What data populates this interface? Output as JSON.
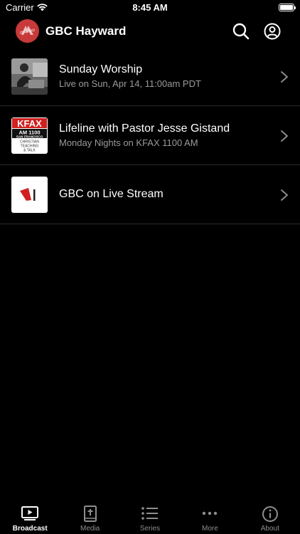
{
  "status_bar": {
    "carrier": "Carrier",
    "time": "8:45 AM"
  },
  "nav": {
    "title": "GBC Hayward",
    "logo_icon": "church-logo-icon",
    "search_icon": "search-icon",
    "account_icon": "account-icon"
  },
  "broadcasts": [
    {
      "title": "Sunday Worship",
      "subtitle": "Live on Sun, Apr 14, 11:00am PDT",
      "thumb": "pastor-photo"
    },
    {
      "title": "Lifeline with Pastor Jesse Gistand",
      "subtitle": "Monday Nights on KFAX 1100 AM",
      "thumb": "kfax-logo",
      "logo_text": {
        "brand": "KFAX",
        "freq": "AM 1100",
        "city": "SAN FRANCISCO",
        "tag1": "CHRISTIAN",
        "tag2": "TEACHING",
        "tag3": "& TALK"
      }
    },
    {
      "title": "GBC on Live Stream",
      "subtitle": "",
      "thumb": "livestream-logo"
    }
  ],
  "tabs": [
    {
      "label": "Broadcast",
      "icon": "play-screen-icon",
      "active": true
    },
    {
      "label": "Media",
      "icon": "bible-icon",
      "active": false
    },
    {
      "label": "Series",
      "icon": "list-icon",
      "active": false
    },
    {
      "label": "More",
      "icon": "ellipsis-icon",
      "active": false
    },
    {
      "label": "About",
      "icon": "info-icon",
      "active": false
    }
  ],
  "colors": {
    "background": "#000000",
    "text": "#ffffff",
    "secondary_text": "#9a9a9a",
    "logo_red": "#c83a3a",
    "kfax_red": "#d0201f"
  }
}
